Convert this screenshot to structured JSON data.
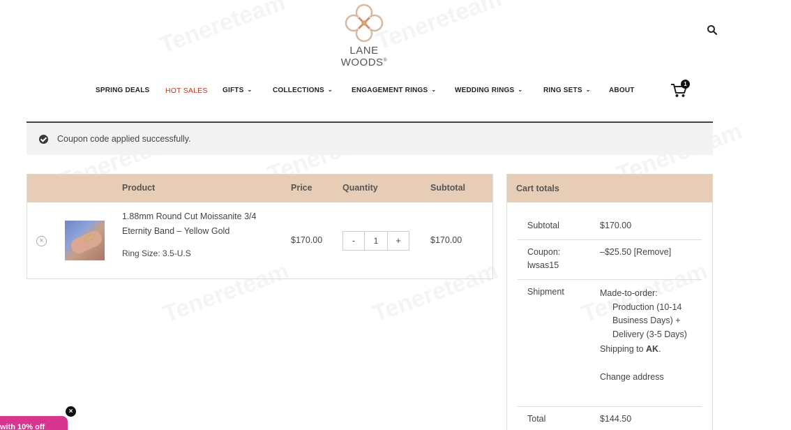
{
  "header": {
    "brand": "LANE WOODS",
    "brand_mark": "®"
  },
  "nav": {
    "items": [
      {
        "label": "SPRING DEALS",
        "has_dropdown": false
      },
      {
        "label": "HOT SALES",
        "has_dropdown": false,
        "highlight": "#b23a2a"
      },
      {
        "label": "GIFTS",
        "has_dropdown": true
      },
      {
        "label": "COLLECTIONS",
        "has_dropdown": true
      },
      {
        "label": "ENGAGEMENT RINGS",
        "has_dropdown": true
      },
      {
        "label": "WEDDING RINGS",
        "has_dropdown": true
      },
      {
        "label": "RING SETS",
        "has_dropdown": true
      },
      {
        "label": "ABOUT",
        "has_dropdown": false
      }
    ],
    "cart_count": "1",
    "chevron": "⌄"
  },
  "notice": {
    "message": "Coupon code applied successfully."
  },
  "cart": {
    "headers": {
      "product": "Product",
      "price": "Price",
      "quantity": "Quantity",
      "subtotal": "Subtotal"
    },
    "item": {
      "name_line1": "1.88mm Round Cut Moissanite 3/4",
      "name_line2": "Eternity Band – Yellow Gold",
      "meta": "Ring Size: 3.5-U.S",
      "price": "$170.00",
      "quantity": "1",
      "subtotal": "$170.00",
      "minus": "-",
      "plus": "+",
      "remove": "×"
    }
  },
  "totals": {
    "title": "Cart totals",
    "subtotal_label": "Subtotal",
    "subtotal_value": "$170.00",
    "coupon_label_line1": "Coupon:",
    "coupon_label_line2": "lwsas15",
    "coupon_value": "–$25.50",
    "coupon_remove": "[Remove]",
    "shipment_label": "Shipment",
    "shipment_line1": "Made-to-order:",
    "shipment_line2": "Production (10-14",
    "shipment_line3": "Business Days) +",
    "shipment_line4": "Delivery (3-5 Days)",
    "shipping_to_prefix": "Shipping to ",
    "shipping_to_state": "AK",
    "shipping_to_suffix": ".",
    "change_address": "Change address",
    "total_label": "Total",
    "total_value": "$144.50"
  },
  "promo": {
    "text": "with 10% off",
    "close": "×"
  },
  "watermark": "Tenereteam",
  "colors": {
    "table_header": "#e8cdb6",
    "promo": "#d8358f"
  }
}
